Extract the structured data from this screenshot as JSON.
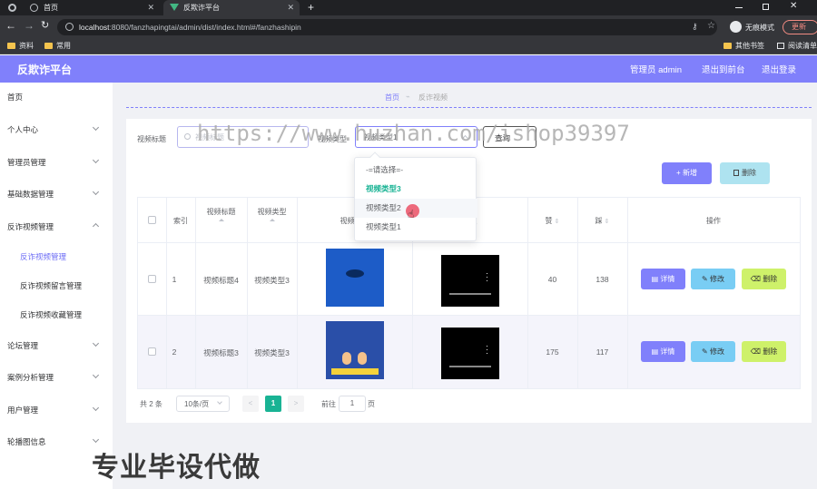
{
  "browser": {
    "tabs": [
      {
        "title": "首页",
        "active": false
      },
      {
        "title": "反欺诈平台",
        "active": true
      }
    ],
    "new_tab": "+",
    "url_host": "localhost",
    "url_rest": ":8080/fanzhapingtai/admin/dist/index.html#/fanzhashipin",
    "incognito_label": "无痕模式",
    "update_label": "更新",
    "bookmarks": [
      "资料",
      "常用"
    ],
    "bookmarks_right": [
      "其他书签",
      "阅读清单"
    ]
  },
  "header": {
    "brand": "反欺诈平台",
    "user": "管理员 admin",
    "to_front": "退出到前台",
    "logout": "退出登录",
    "accent": "#8080fb"
  },
  "sidebar": {
    "items": [
      {
        "label": "首页",
        "chev": false
      },
      {
        "label": "个人中心",
        "chev": true
      },
      {
        "label": "管理员管理",
        "chev": true
      },
      {
        "label": "基础数据管理",
        "chev": true
      },
      {
        "label": "反诈视频管理",
        "chev": true
      },
      {
        "label": "论坛管理",
        "chev": true
      },
      {
        "label": "案例分析管理",
        "chev": true
      },
      {
        "label": "用户管理",
        "chev": true
      },
      {
        "label": "轮播图信息",
        "chev": true
      }
    ],
    "subitems": [
      {
        "label": "反诈视频管理",
        "active": true
      },
      {
        "label": "反诈视频留言管理",
        "active": false
      },
      {
        "label": "反诈视频收藏管理",
        "active": false
      }
    ]
  },
  "breadcrumb": {
    "home": "首页",
    "current": "反诈视频"
  },
  "search": {
    "title_label": "视频标题",
    "title_placeholder": "视频标题",
    "type_label": "视频类型",
    "type_value": "视频类型1",
    "query_button": "查询"
  },
  "dropdown": {
    "options": [
      {
        "label": "-=请选择=-",
        "state": "normal"
      },
      {
        "label": "视频类型3",
        "state": "selected"
      },
      {
        "label": "视频类型2",
        "state": "hover"
      },
      {
        "label": "视频类型1",
        "state": "normal"
      }
    ]
  },
  "actions": {
    "add": "+ 新增",
    "delete": "删除"
  },
  "table": {
    "headers": [
      "索引",
      "视频标题",
      "视频类型",
      "视频封面",
      "视频",
      "赞",
      "踩",
      "操作"
    ],
    "rows": [
      {
        "index": "1",
        "title": "视频标题4",
        "type": "视频类型3",
        "likes": "40",
        "dislikes": "138"
      },
      {
        "index": "2",
        "title": "视频标题3",
        "type": "视频类型3",
        "likes": "175",
        "dislikes": "117"
      }
    ],
    "row_actions": {
      "detail": "详情",
      "edit": "修改",
      "delete": "删除"
    }
  },
  "pagination": {
    "total": "共 2 条",
    "page_size": "10条/页",
    "prev": "<",
    "current": "1",
    "next": ">",
    "goto_label": "前往",
    "goto_value": "1",
    "page_unit": "页"
  },
  "watermark": {
    "url": "https://www.huzhan.com/ishop39397",
    "slogan": "专业毕设代做"
  }
}
